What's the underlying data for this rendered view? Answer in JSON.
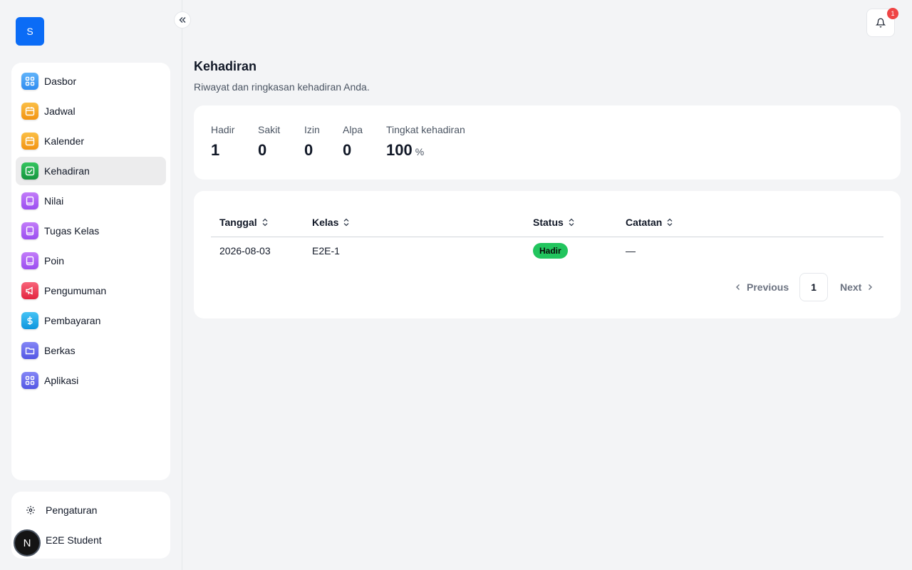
{
  "app": {
    "logo_letter": "S"
  },
  "sidebar": {
    "items": [
      {
        "label": "Dasbor",
        "icon": "dashboard-icon",
        "color": "#3b9cf6",
        "active": false
      },
      {
        "label": "Jadwal",
        "icon": "calendar-icon",
        "color": "#f59e0b",
        "active": false
      },
      {
        "label": "Kalender",
        "icon": "calendar-icon",
        "color": "#f59e0b",
        "active": false
      },
      {
        "label": "Kehadiran",
        "icon": "check-square-icon",
        "color": "#16a34a",
        "active": true
      },
      {
        "label": "Nilai",
        "icon": "book-icon",
        "color": "#a855f7",
        "active": false
      },
      {
        "label": "Tugas Kelas",
        "icon": "book-icon",
        "color": "#a855f7",
        "active": false
      },
      {
        "label": "Poin",
        "icon": "book-icon",
        "color": "#a855f7",
        "active": false
      },
      {
        "label": "Pengumuman",
        "icon": "megaphone-icon",
        "color": "#ef4444",
        "active": false
      },
      {
        "label": "Pembayaran",
        "icon": "dollar-icon",
        "color": "#0ea5e9",
        "active": false
      },
      {
        "label": "Berkas",
        "icon": "folder-icon",
        "color": "#6366f1",
        "active": false
      },
      {
        "label": "Aplikasi",
        "icon": "apps-grid-icon",
        "color": "#6366f1",
        "active": false
      }
    ],
    "settings_label": "Pengaturan",
    "user_name": "E2E Student",
    "avatar_letter": "N"
  },
  "header": {
    "notification_count": "1"
  },
  "main": {
    "title": "Kehadiran",
    "subtitle": "Riwayat dan ringkasan kehadiran Anda.",
    "stats": {
      "present": {
        "label": "Hadir",
        "value": "1"
      },
      "sick": {
        "label": "Sakit",
        "value": "0"
      },
      "permit": {
        "label": "Izin",
        "value": "0"
      },
      "absent": {
        "label": "Alpa",
        "value": "0"
      },
      "rate": {
        "label": "Tingkat kehadiran",
        "value": "100",
        "unit": "%"
      }
    },
    "table": {
      "columns": [
        "Tanggal",
        "Kelas",
        "Status",
        "Catatan"
      ],
      "rows": [
        {
          "date": "2026-08-03",
          "class": "E2E-1",
          "status": "Hadir",
          "status_color": "#22c55e",
          "note": "—"
        }
      ]
    },
    "pagination": {
      "previous": "Previous",
      "page": "1",
      "next": "Next"
    }
  }
}
